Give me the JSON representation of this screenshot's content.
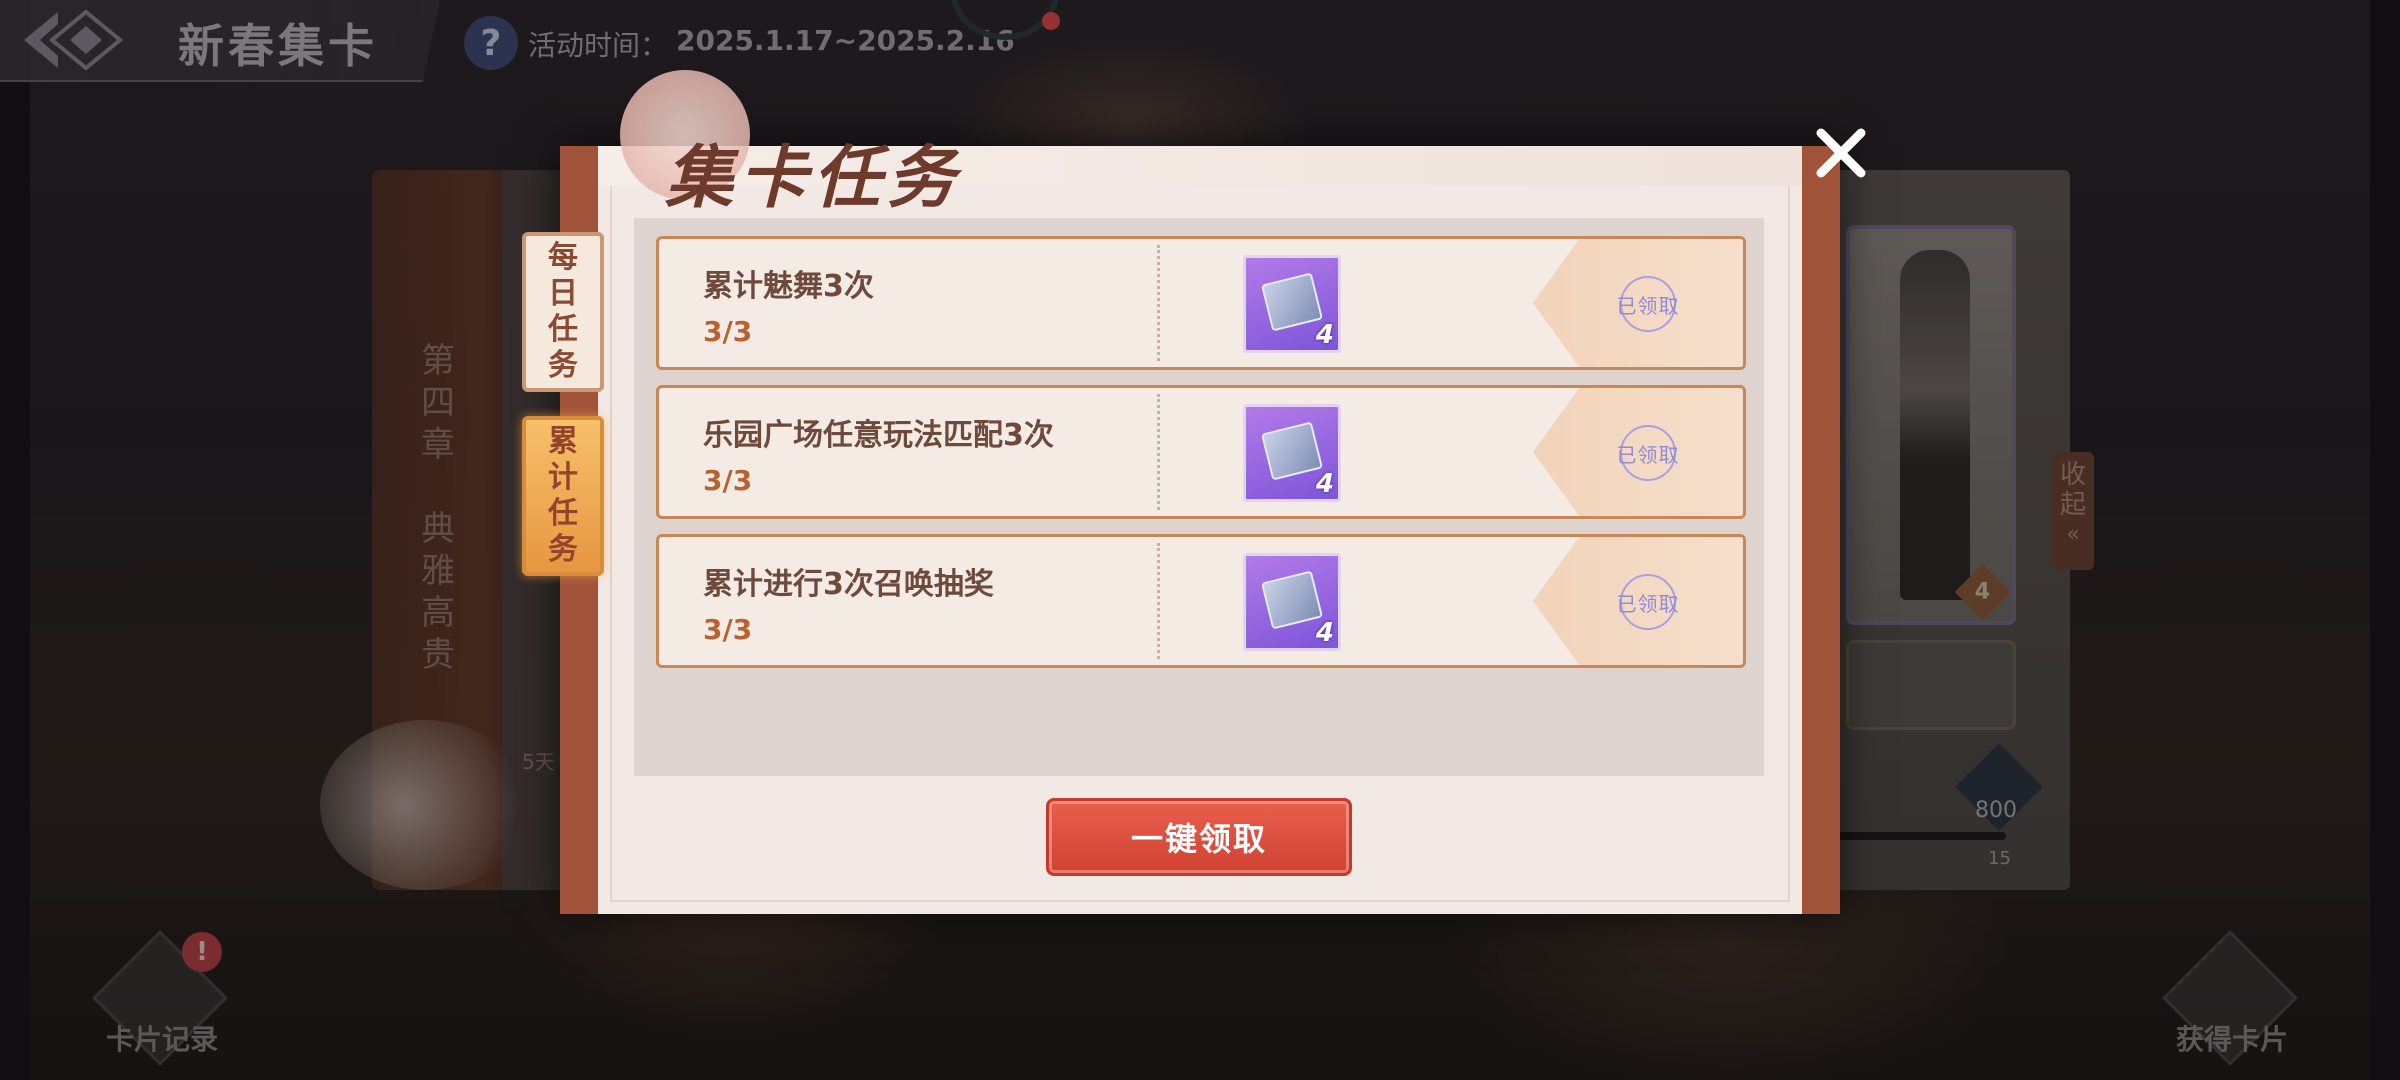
{
  "header": {
    "title": "新春集卡",
    "time_label": "活动时间：",
    "time_value": "2025.1.17~2025.2.16"
  },
  "background": {
    "chapter_text": [
      "第",
      "四",
      "章",
      "",
      "典",
      "雅",
      "高",
      "贵"
    ],
    "days_text": "5天",
    "right_card_badge": "4",
    "right_counter": "800",
    "right_progress": "15",
    "collapse_label": "收起"
  },
  "modal": {
    "title": "集卡任务",
    "tabs": [
      {
        "label": "每日任务",
        "active": false
      },
      {
        "label": "累计任务",
        "active": true
      }
    ],
    "tasks": [
      {
        "name": "累计魅舞3次",
        "progress": "3/3",
        "reward_qty": "4",
        "status": "已领取"
      },
      {
        "name": "乐园广场任意玩法匹配3次",
        "progress": "3/3",
        "reward_qty": "4",
        "status": "已领取"
      },
      {
        "name": "累计进行3次召唤抽奖",
        "progress": "3/3",
        "reward_qty": "4",
        "status": "已领取"
      }
    ],
    "claim_all_label": "一键领取"
  },
  "bottom": {
    "card_record_label": "卡片记录",
    "card_record_alert": "!",
    "get_cards_label": "获得卡片"
  },
  "colors": {
    "modal_frame": "#a1533a",
    "task_border": "#c98755",
    "claim_button": "#d9493a",
    "active_tab": "#f0ab52",
    "claimed_stamp": "#938ad8"
  }
}
